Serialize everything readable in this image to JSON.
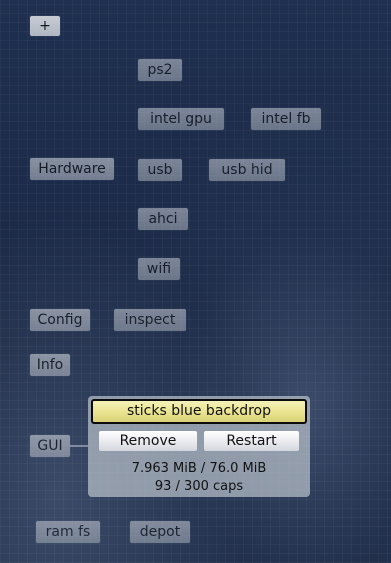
{
  "toolbar": {
    "add_label": "+"
  },
  "nodes": {
    "ps2": "ps2",
    "intel_gpu": "intel gpu",
    "intel_fb": "intel fb",
    "hardware": "Hardware",
    "usb": "usb",
    "usb_hid": "usb hid",
    "ahci": "ahci",
    "wifi": "wifi",
    "config": "Config",
    "inspect": "inspect",
    "info": "Info",
    "gui": "GUI",
    "ram_fs": "ram fs",
    "depot": "depot"
  },
  "popup": {
    "title": "sticks blue backdrop",
    "remove_label": "Remove",
    "restart_label": "Restart",
    "memory": "7.963 MiB / 76.0 MiB",
    "caps": "93 / 300 caps"
  }
}
